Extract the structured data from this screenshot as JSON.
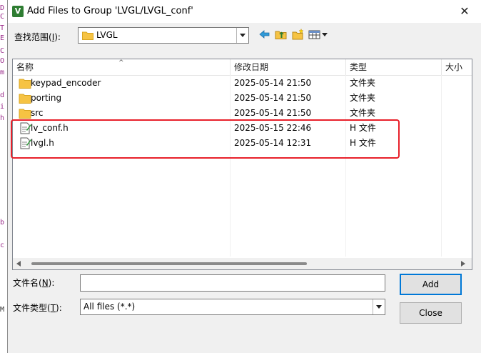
{
  "background_text": {
    "left_chars": [
      "D",
      "C",
      "T",
      "E",
      "C",
      "O",
      "m",
      "d",
      "i",
      "h",
      "b",
      "c",
      "M"
    ]
  },
  "window": {
    "app_icon": "V",
    "title": "Add Files to Group 'LVGL/LVGL_conf'",
    "close_glyph": "✕"
  },
  "look_in": {
    "label_prefix": "查找范围(",
    "label_key": "I",
    "label_suffix": "):",
    "value": "LVGL"
  },
  "toolbar": {
    "icons": [
      "back-arrow-icon",
      "up-folder-icon",
      "new-folder-icon",
      "view-menu-icon"
    ]
  },
  "file_list": {
    "columns": [
      "名称",
      "修改日期",
      "类型",
      "大小"
    ],
    "sort_indicator": "^",
    "rows": [
      {
        "name": "keypad_encoder",
        "date": "2025-05-14 21:50",
        "type": "文件夹",
        "icon": "folder-icon"
      },
      {
        "name": "porting",
        "date": "2025-05-14 21:50",
        "type": "文件夹",
        "icon": "folder-icon"
      },
      {
        "name": "src",
        "date": "2025-05-14 21:50",
        "type": "文件夹",
        "icon": "folder-icon"
      },
      {
        "name": "lv_conf.h",
        "date": "2025-05-15 22:46",
        "type": "H 文件",
        "icon": "header-file-icon"
      },
      {
        "name": "lvgl.h",
        "date": "2025-05-14 12:31",
        "type": "H 文件",
        "icon": "header-file-icon"
      }
    ]
  },
  "filename": {
    "label_prefix": "文件名(",
    "label_key": "N",
    "label_suffix": "):",
    "value": ""
  },
  "filetype": {
    "label_prefix": "文件类型(",
    "label_key": "T",
    "label_suffix": "):",
    "value": "All files (*.*)"
  },
  "buttons": {
    "add": "Add",
    "close": "Close"
  },
  "colors": {
    "highlight": "#e8202a",
    "folder": "#f6c343",
    "accent": "#0078d7"
  }
}
